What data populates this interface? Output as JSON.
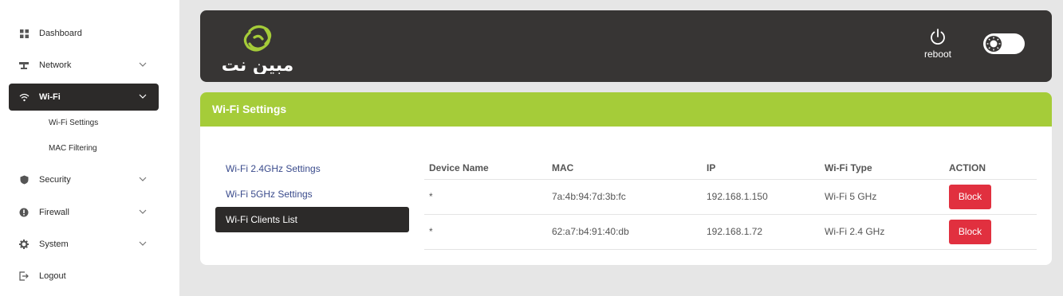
{
  "sidebar": {
    "items": [
      {
        "label": "Dashboard",
        "icon": "grid-icon"
      },
      {
        "label": "Network",
        "icon": "network-icon",
        "expandable": true
      },
      {
        "label": "Wi-Fi",
        "icon": "wifi-icon",
        "expandable": true,
        "active": true
      },
      {
        "label": "Security",
        "icon": "shield-icon",
        "expandable": true
      },
      {
        "label": "Firewall",
        "icon": "firewall-icon",
        "expandable": true
      },
      {
        "label": "System",
        "icon": "gear-icon",
        "expandable": true
      },
      {
        "label": "Logout",
        "icon": "logout-icon"
      }
    ],
    "subitems": [
      "Wi-Fi Settings",
      "MAC Filtering"
    ]
  },
  "header": {
    "logo_text": "مبین نت",
    "reboot_label": "reboot"
  },
  "card": {
    "title": "Wi-Fi Settings",
    "tabs": [
      "Wi-Fi 2.4GHz Settings",
      "Wi-Fi 5GHz Settings",
      "Wi-Fi Clients List"
    ],
    "active_tab": "Wi-Fi Clients List",
    "table": {
      "columns": [
        "Device Name",
        "MAC",
        "IP",
        "Wi-Fi Type",
        "ACTION"
      ],
      "rows": [
        {
          "device": "*",
          "mac": "7a:4b:94:7d:3b:fc",
          "ip": "192.168.1.150",
          "type": "Wi-Fi 5 GHz",
          "action": "Block"
        },
        {
          "device": "*",
          "mac": "62:a7:b4:91:40:db",
          "ip": "192.168.1.72",
          "type": "Wi-Fi 2.4 GHz",
          "action": "Block"
        }
      ]
    }
  },
  "colors": {
    "accent_green": "#a5cc39",
    "dark": "#2c2a29",
    "header": "#373534",
    "danger": "#e1303f",
    "link": "#3a4b8c"
  }
}
